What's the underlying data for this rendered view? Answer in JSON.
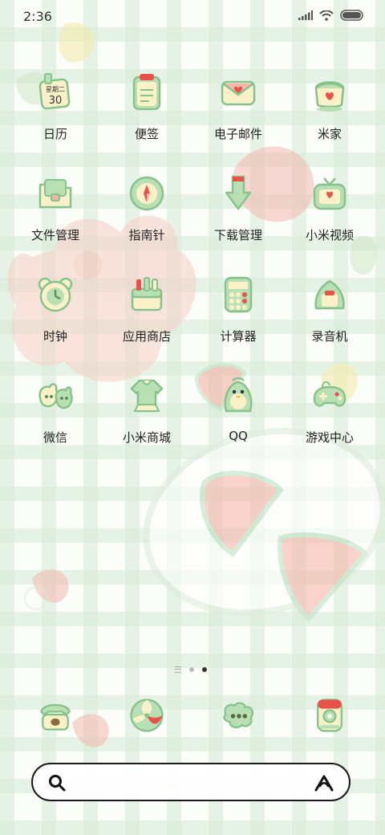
{
  "status": {
    "time": "2:36"
  },
  "apps": [
    {
      "label": "日历",
      "icon": "calendar-icon",
      "date_text": "星期二",
      "date_num": "30"
    },
    {
      "label": "便签",
      "icon": "notes-icon"
    },
    {
      "label": "电子邮件",
      "icon": "mail-icon"
    },
    {
      "label": "米家",
      "icon": "home-icon"
    },
    {
      "label": "文件管理",
      "icon": "folder-icon"
    },
    {
      "label": "指南针",
      "icon": "compass-icon"
    },
    {
      "label": "下载管理",
      "icon": "download-icon"
    },
    {
      "label": "小米视频",
      "icon": "tv-icon"
    },
    {
      "label": "时钟",
      "icon": "clock-icon"
    },
    {
      "label": "应用商店",
      "icon": "store-icon"
    },
    {
      "label": "计算器",
      "icon": "calculator-icon"
    },
    {
      "label": "录音机",
      "icon": "recorder-icon"
    },
    {
      "label": "微信",
      "icon": "wechat-icon"
    },
    {
      "label": "小米商城",
      "icon": "mall-icon"
    },
    {
      "label": "QQ",
      "icon": "qq-icon"
    },
    {
      "label": "游戏中心",
      "icon": "gamepad-icon"
    }
  ],
  "dock": [
    {
      "icon": "phone-icon"
    },
    {
      "icon": "browser-icon"
    },
    {
      "icon": "messages-icon"
    },
    {
      "icon": "camera-icon"
    }
  ],
  "pager": {
    "pages": 2,
    "current": 2
  },
  "colors": {
    "green": "#b9dfb4",
    "cream": "#fbf1c9",
    "pink": "#f3b6ad",
    "red": "#e8524a",
    "outline": "#86c38a"
  }
}
